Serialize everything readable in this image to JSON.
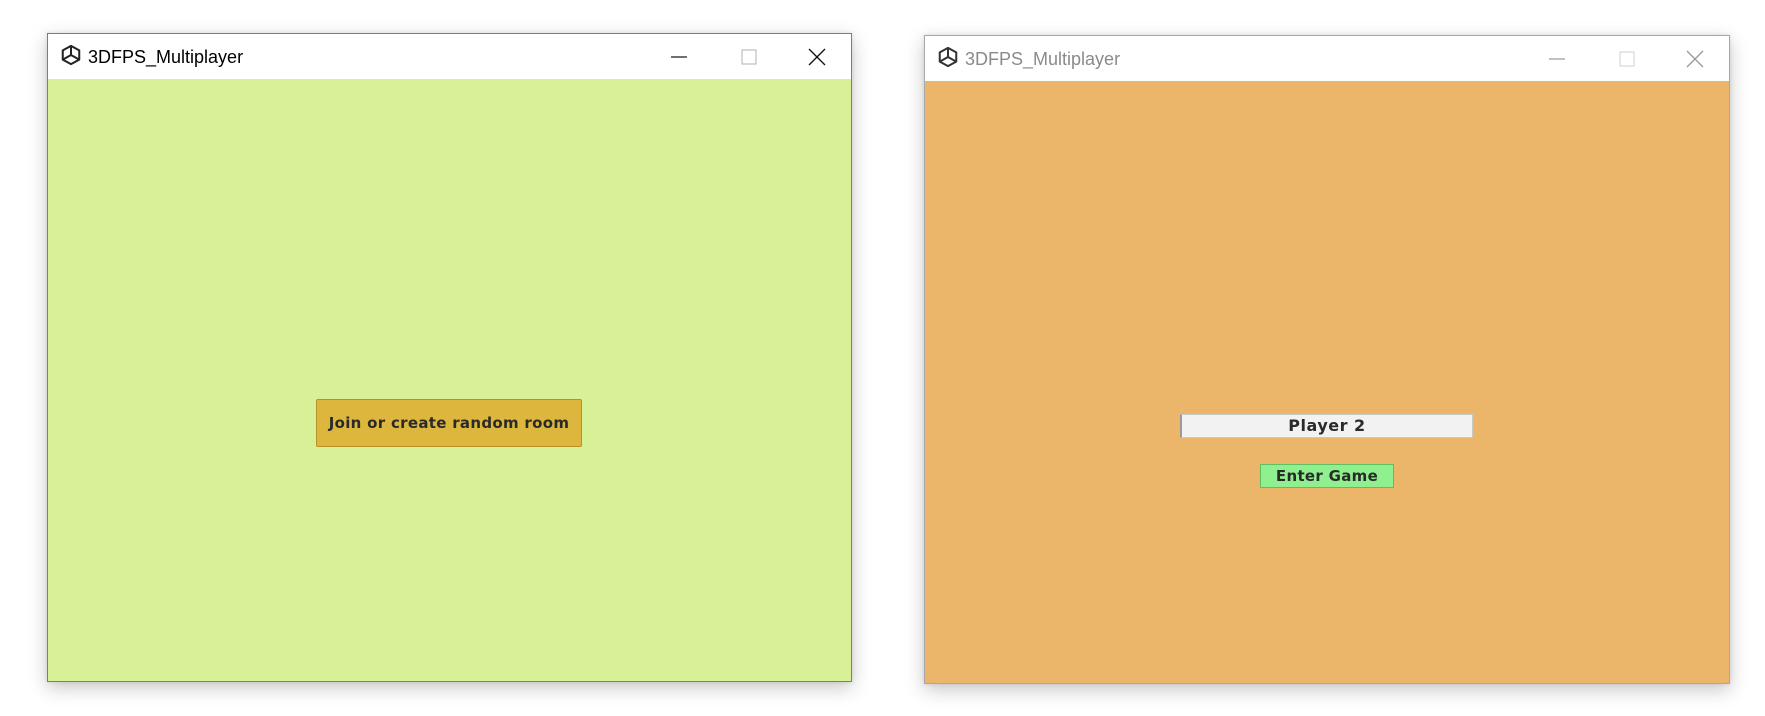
{
  "windows": {
    "left": {
      "title": "3DFPS_Multiplayer",
      "background_color": "#d9f196",
      "join_button_label": "Join or create random room",
      "join_button_color": "#ddb63d",
      "active": true
    },
    "right": {
      "title": "3DFPS_Multiplayer",
      "background_color": "#ebb66a",
      "player_name_value": "Player 2",
      "enter_button_label": "Enter Game",
      "enter_button_color": "#8ff08f",
      "active": false
    }
  },
  "icons": {
    "app": "unity-logo-icon",
    "minimize": "minimize-icon",
    "maximize": "maximize-icon",
    "close": "close-icon"
  }
}
